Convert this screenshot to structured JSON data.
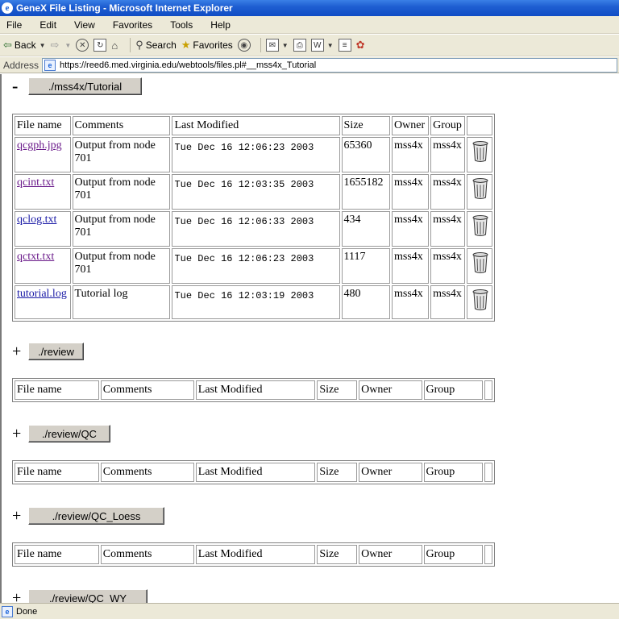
{
  "window": {
    "title": "GeneX File Listing - Microsoft Internet Explorer"
  },
  "menu": [
    "File",
    "Edit",
    "View",
    "Favorites",
    "Tools",
    "Help"
  ],
  "toolbar": {
    "back": "Back",
    "search": "Search",
    "favorites": "Favorites"
  },
  "address": {
    "label": "Address",
    "url": "https://reed6.med.virginia.edu/webtools/files.pl#__mss4x_Tutorial"
  },
  "columns": [
    "File name",
    "Comments",
    "Last Modified",
    "Size",
    "Owner",
    "Group"
  ],
  "sections": [
    {
      "toggle": "-",
      "dir": "./mss4x/Tutorial",
      "files": [
        {
          "name": "qcgph.jpg",
          "comment": "Output from node 701",
          "modified": "Tue Dec 16 12:06:23 2003",
          "size": "65360",
          "owner": "mss4x",
          "group": "mss4x"
        },
        {
          "name": "qcint.txt",
          "comment": "Output from node 701",
          "modified": "Tue Dec 16 12:03:35 2003",
          "size": "1655182",
          "owner": "mss4x",
          "group": "mss4x"
        },
        {
          "name": "qclog.txt",
          "comment": "Output from node 701",
          "modified": "Tue Dec 16 12:06:33 2003",
          "size": "434",
          "owner": "mss4x",
          "group": "mss4x"
        },
        {
          "name": "qctxt.txt",
          "comment": "Output from node 701",
          "modified": "Tue Dec 16 12:06:23 2003",
          "size": "1117",
          "owner": "mss4x",
          "group": "mss4x"
        },
        {
          "name": "tutorial.log",
          "comment": "Tutorial log",
          "modified": "Tue Dec 16 12:03:19 2003",
          "size": "480",
          "owner": "mss4x",
          "group": "mss4x"
        }
      ]
    },
    {
      "toggle": "+",
      "dir": "./review"
    },
    {
      "toggle": "+",
      "dir": "./review/QC"
    },
    {
      "toggle": "+",
      "dir": "./review/QC_Loess"
    },
    {
      "toggle": "+",
      "dir": "./review/QC_WY"
    }
  ],
  "status": {
    "text": "Done"
  }
}
